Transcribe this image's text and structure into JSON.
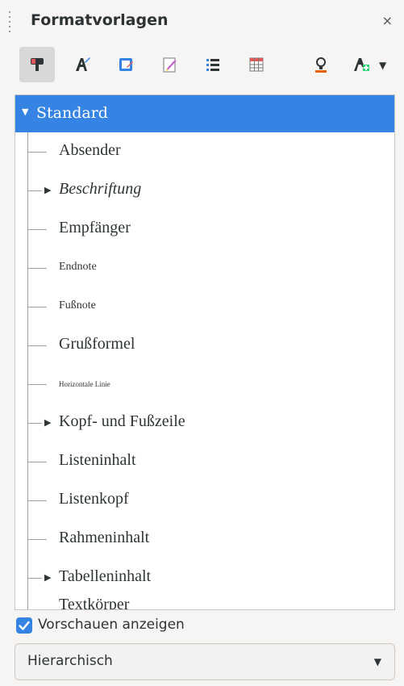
{
  "panel": {
    "title": "Formatvorlagen",
    "close_glyph": "×"
  },
  "toolbar": {
    "buttons": [
      {
        "name": "paragraph-styles-icon",
        "active": true
      },
      {
        "name": "character-styles-icon",
        "active": false
      },
      {
        "name": "frame-styles-icon",
        "active": false
      },
      {
        "name": "page-styles-icon",
        "active": false
      },
      {
        "name": "list-styles-icon",
        "active": false
      },
      {
        "name": "table-styles-icon",
        "active": false
      },
      {
        "name": "fill-format-mode-icon",
        "active": false
      },
      {
        "name": "new-style-icon",
        "active": false
      }
    ],
    "dropdown_glyph": "▼"
  },
  "tree": {
    "root": {
      "label": "Standard",
      "expanded": true,
      "glyph": "▼"
    },
    "children": [
      {
        "label": "Absender",
        "expandable": false
      },
      {
        "label": "Beschriftung",
        "expandable": true
      },
      {
        "label": "Empfänger",
        "expandable": false
      },
      {
        "label": "Endnote",
        "expandable": false
      },
      {
        "label": "Fußnote",
        "expandable": false
      },
      {
        "label": "Grußformel",
        "expandable": false
      },
      {
        "label": "Horizontale Linie",
        "expandable": false
      },
      {
        "label": "Kopf- und Fußzeile",
        "expandable": true
      },
      {
        "label": "Listeninhalt",
        "expandable": false
      },
      {
        "label": "Listenkopf",
        "expandable": false
      },
      {
        "label": "Rahmeninhalt",
        "expandable": false
      },
      {
        "label": "Tabelleninhalt",
        "expandable": true
      },
      {
        "label": "Textkörper",
        "expandable": false
      }
    ],
    "expander_glyph": "▶"
  },
  "preview_checkbox": {
    "label": "Vorschauen anzeigen",
    "checked": true
  },
  "filter_combo": {
    "value": "Hierarchisch",
    "arrow": "▼"
  },
  "colors": {
    "accent": "#3584e4",
    "background": "#f6f5f4"
  }
}
